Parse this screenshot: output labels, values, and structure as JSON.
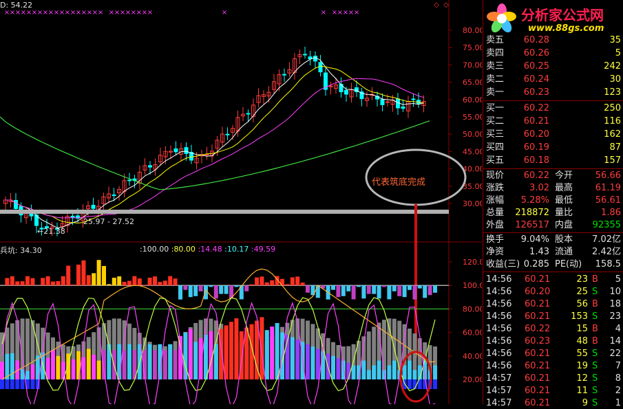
{
  "main_panel": {
    "indicator_label": "D: 54.22",
    "low_label": "←21.38",
    "range_label": "25.97 - 27.52",
    "annotation": "代表筑底完成",
    "y_ticks": [
      "80.00",
      "75.00",
      "70.00",
      "65.00",
      "60.00",
      "55.00",
      "50.00",
      "45.00",
      "40.00",
      "35.00",
      "30.00"
    ],
    "colors": {
      "up": "#ff3c3c",
      "down": "#00ffff",
      "ma5": "#ffffff",
      "ma10": "#ffff00",
      "ma20": "#ff40ff",
      "ma60": "#40e040",
      "grid": "#8a0000",
      "band": "#b0b0b0"
    }
  },
  "sub_panel": {
    "title": "兵坑: 34.30",
    "values": [
      "100.00",
      "80.00",
      "14.48",
      "10.17",
      "49.59"
    ],
    "y_ticks": [
      "120.00",
      "100.00",
      "80.00",
      "60.00",
      "40.00",
      "20.00"
    ]
  },
  "logo": {
    "name": "分析家公式网",
    "url": "www.88gs.com"
  },
  "order_book": {
    "asks": [
      {
        "label": "卖五",
        "price": "60.28",
        "vol": "35"
      },
      {
        "label": "卖四",
        "price": "60.26",
        "vol": "5"
      },
      {
        "label": "卖三",
        "price": "60.25",
        "vol": "242"
      },
      {
        "label": "卖二",
        "price": "60.24",
        "vol": "30"
      },
      {
        "label": "卖一",
        "price": "60.23",
        "vol": "123"
      }
    ],
    "bids": [
      {
        "label": "买一",
        "price": "60.22",
        "vol": "250"
      },
      {
        "label": "买二",
        "price": "60.21",
        "vol": "116"
      },
      {
        "label": "买三",
        "price": "60.20",
        "vol": "162"
      },
      {
        "label": "买四",
        "price": "60.19",
        "vol": "87"
      },
      {
        "label": "买五",
        "price": "60.18",
        "vol": "157"
      }
    ]
  },
  "quote": {
    "rows": [
      {
        "l1": "现价",
        "v1": "60.22",
        "l2": "今开",
        "v2": "56.66",
        "c1": "red",
        "c2": "red"
      },
      {
        "l1": "涨跌",
        "v1": "3.02",
        "l2": "最高",
        "v2": "61.19",
        "c1": "red",
        "c2": "red"
      },
      {
        "l1": "涨幅",
        "v1": "5.28%",
        "l2": "最低",
        "v2": "56.61",
        "c1": "red",
        "c2": "red"
      },
      {
        "l1": "总量",
        "v1": "218872",
        "l2": "量比",
        "v2": "1.86",
        "c1": "yellow",
        "c2": "red"
      },
      {
        "l1": "外盘",
        "v1": "126517",
        "l2": "内盘",
        "v2": "92355",
        "c1": "red",
        "c2": "green"
      }
    ],
    "rows2": [
      {
        "l1": "换手",
        "v1": "9.04%",
        "l2": "股本",
        "v2": "7.02亿"
      },
      {
        "l1": "净资",
        "v1": "1.43",
        "l2": "流通",
        "v2": "2.42亿"
      },
      {
        "l1": "收益(三)",
        "v1": "0.285",
        "l2": "PE(动)",
        "v2": "158.5"
      }
    ]
  },
  "ticks": [
    {
      "time": "14:56",
      "price": "60.21",
      "vol": "23",
      "side": "B",
      "n": "5"
    },
    {
      "time": "14:56",
      "price": "60.20",
      "vol": "25",
      "side": "S",
      "n": "10"
    },
    {
      "time": "14:56",
      "price": "60.21",
      "vol": "56",
      "side": "B",
      "n": "18"
    },
    {
      "time": "14:56",
      "price": "60.21",
      "vol": "153",
      "side": "S",
      "n": "23"
    },
    {
      "time": "14:56",
      "price": "60.22",
      "vol": "15",
      "side": "B",
      "n": "4"
    },
    {
      "time": "14:56",
      "price": "60.23",
      "vol": "48",
      "side": "B",
      "n": "14"
    },
    {
      "time": "14:56",
      "price": "60.21",
      "vol": "55",
      "side": "S",
      "n": "22"
    },
    {
      "time": "14:56",
      "price": "60.21",
      "vol": "19",
      "side": "S",
      "n": "7"
    },
    {
      "time": "14:57",
      "price": "60.21",
      "vol": "12",
      "side": "S",
      "n": "8"
    },
    {
      "time": "14:57",
      "price": "60.21",
      "vol": "11",
      "side": "S",
      "n": "2"
    },
    {
      "time": "14:57",
      "price": "60.21",
      "vol": "9",
      "side": "S",
      "n": "1"
    }
  ]
}
